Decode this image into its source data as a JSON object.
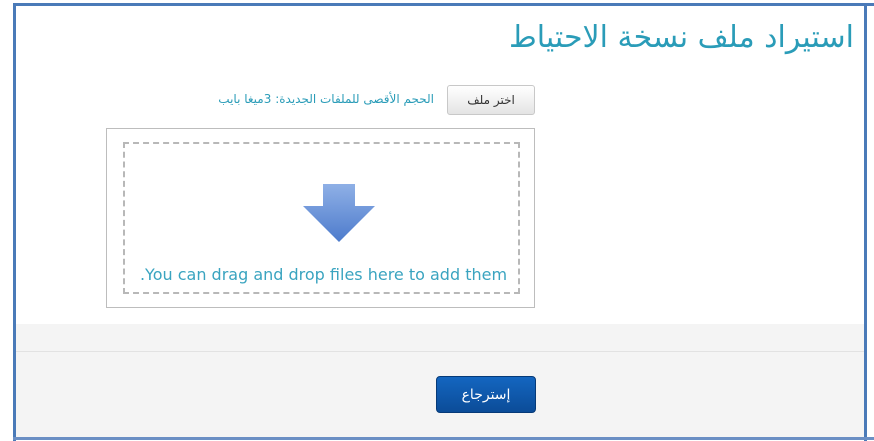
{
  "page": {
    "title": "استيراد ملف نسخة الاحتياط"
  },
  "file_picker": {
    "choose_button_label": "اختر ملف",
    "max_size_text": "الحجم الأقصى للملفات الجديدة: 3ميغا بايب"
  },
  "drop_zone": {
    "instruction": "You can drag and drop files here to add them.",
    "arrow_icon": "arrow-down-icon"
  },
  "footer": {
    "restore_button_label": "إسترجاع"
  },
  "colors": {
    "accent": "#2a9cb8",
    "button_primary": "#0b4c98",
    "border": "#4a7ab8"
  }
}
